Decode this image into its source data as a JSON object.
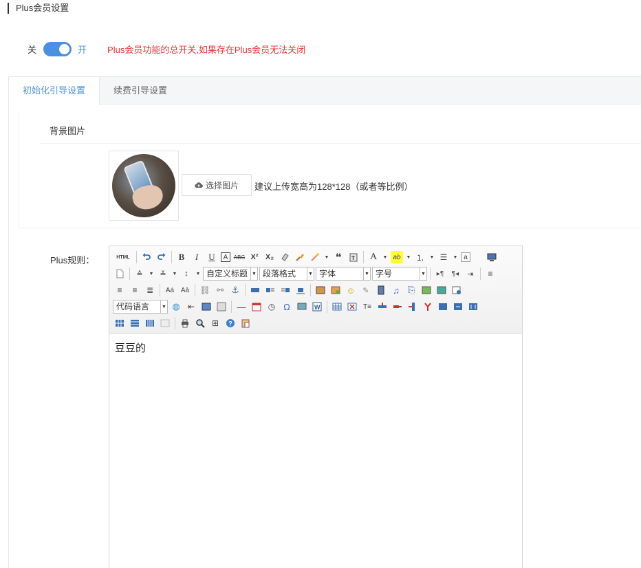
{
  "section": {
    "title": "Plus会员设置"
  },
  "master_switch": {
    "off_label": "关",
    "on_label": "开",
    "state": "on",
    "hint": "Plus会员功能的总开关,如果存在Plus会员无法关闭"
  },
  "tabs": [
    {
      "label": "初始化引导设置",
      "active": true
    },
    {
      "label": "续费引导设置",
      "active": false
    }
  ],
  "background": {
    "label": "背景图片",
    "upload_label": "选择图片",
    "hint": "建议上传宽高为128*128（或者等比例）"
  },
  "rules": {
    "label": "Plus规则：",
    "content": "豆豆的"
  },
  "editor": {
    "html_label": "HTML",
    "combos": {
      "heading": "自定义标题",
      "paragraph": "段落格式",
      "font": "字体",
      "size": "字号",
      "code": "代码语言"
    }
  },
  "colors": {
    "accent": "#4a90e2",
    "hint_red": "#e33"
  }
}
